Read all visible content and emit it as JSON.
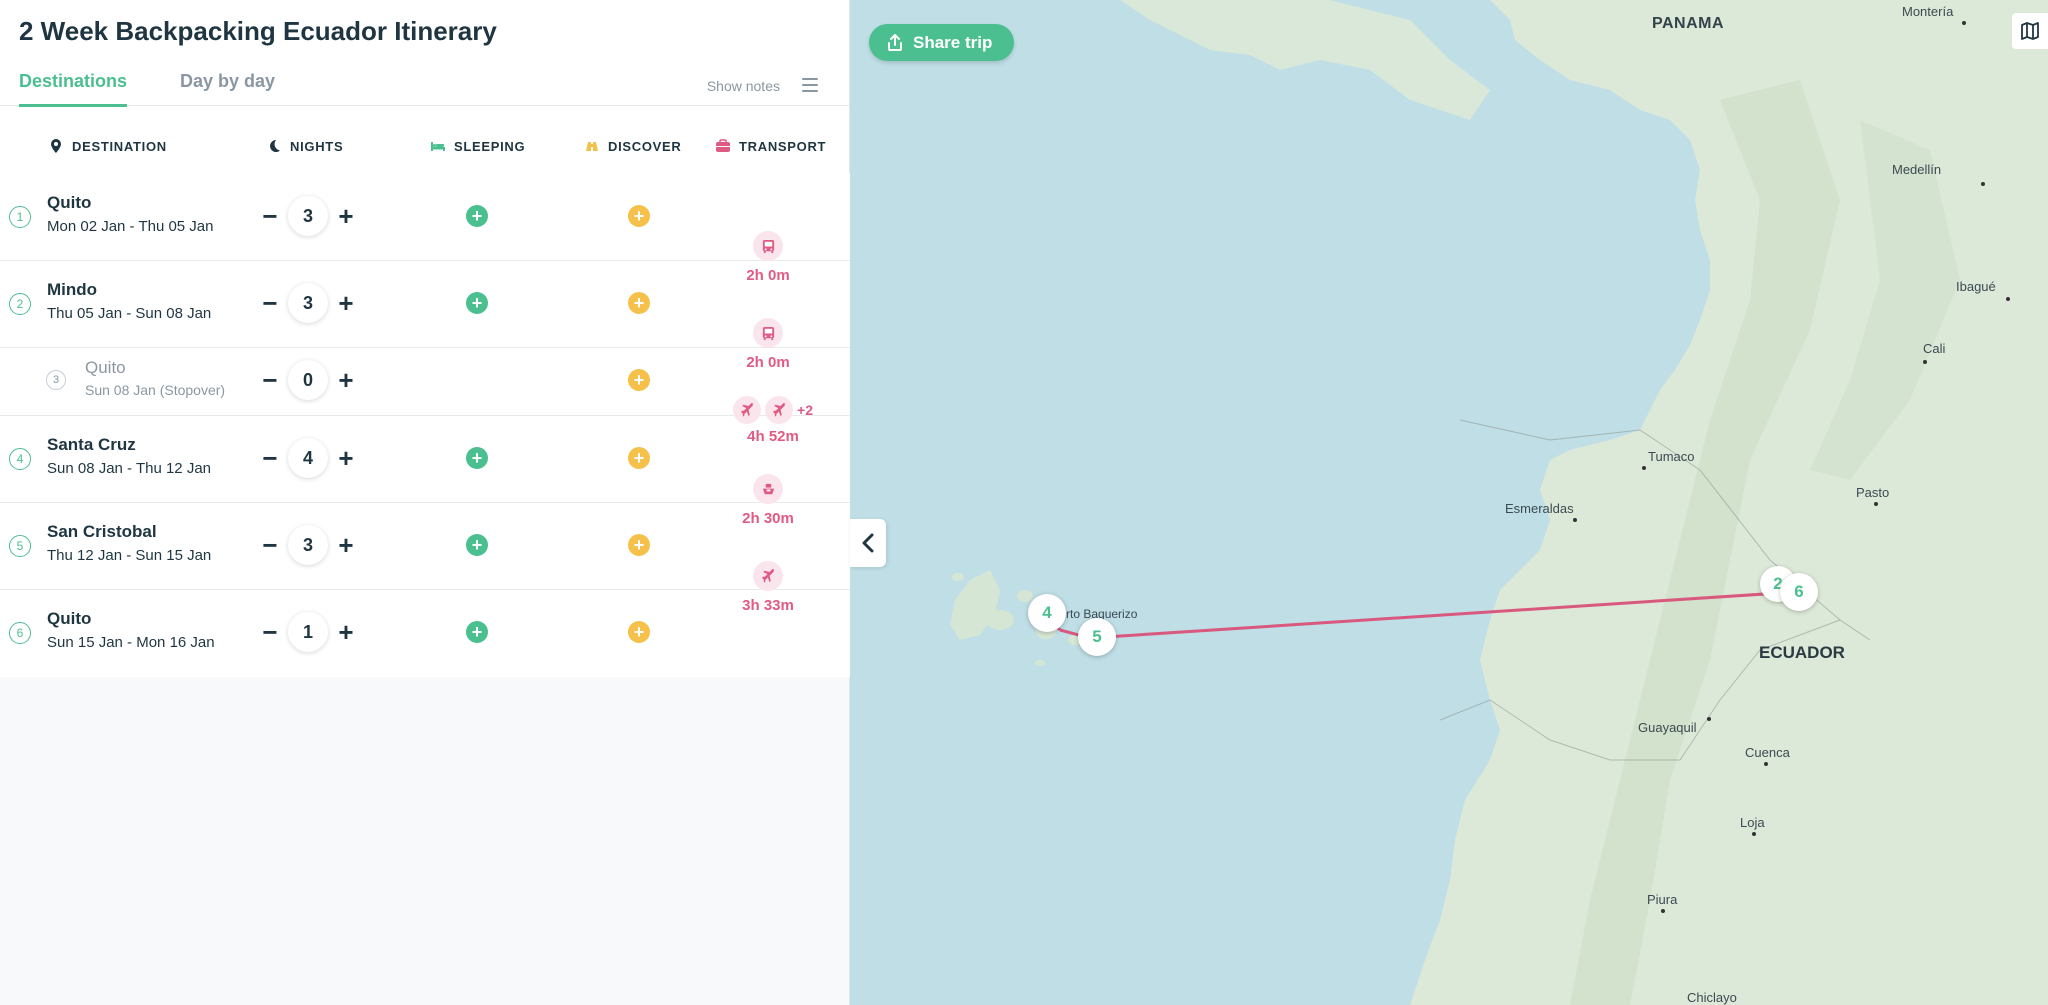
{
  "title": "2 Week Backpacking Ecuador Itinerary",
  "tabs": [
    {
      "label": "Destinations",
      "active": true
    },
    {
      "label": "Day by day",
      "active": false
    }
  ],
  "toolbar": {
    "show_notes": "Show notes"
  },
  "columns": {
    "destination": "DESTINATION",
    "nights": "NIGHTS",
    "sleeping": "SLEEPING",
    "discover": "DISCOVER",
    "transport": "TRANSPORT"
  },
  "rows": [
    {
      "num": "1",
      "name": "Quito",
      "dates": "Mon 02 Jan - Thu 05 Jan",
      "nights": "3"
    },
    {
      "num": "2",
      "name": "Mindo",
      "dates": "Thu 05 Jan - Sun 08 Jan",
      "nights": "3"
    },
    {
      "num": "3",
      "name": "Quito",
      "dates": "Sun 08 Jan (Stopover)",
      "nights": "0"
    },
    {
      "num": "4",
      "name": "Santa Cruz",
      "dates": "Sun 08 Jan - Thu 12 Jan",
      "nights": "4"
    },
    {
      "num": "5",
      "name": "San Cristobal",
      "dates": "Thu 12 Jan - Sun 15 Jan",
      "nights": "3"
    },
    {
      "num": "6",
      "name": "Quito",
      "dates": "Sun 15 Jan - Mon 16 Jan",
      "nights": "1"
    }
  ],
  "transport": [
    {
      "icon": "bus-icon",
      "time": "2h 0m"
    },
    {
      "icon": "bus-icon",
      "time": "2h 0m"
    },
    {
      "icon": "plane-icon",
      "more": "+2",
      "time": "4h 52m"
    },
    {
      "icon": "ferry-icon",
      "time": "2h 30m"
    },
    {
      "icon": "plane-icon",
      "time": "3h 33m"
    }
  ],
  "map": {
    "share_label": "Share trip",
    "labels": {
      "panama": "PANAMA",
      "ecuador": "ECUADOR",
      "monteria": "Montería",
      "medellin": "Medellín",
      "ibague": "Ibagué",
      "cali": "Cali",
      "tumaco": "Tumaco",
      "pasto": "Pasto",
      "esmeraldas": "Esmeraldas",
      "guayaquil": "Guayaquil",
      "cuenca": "Cuenca",
      "loja": "Loja",
      "piura": "Piura",
      "chiclayo": "Chiclayo",
      "puerto_baquerizo": "rto Baquerizo"
    },
    "markers": {
      "m2": "2",
      "m4": "4",
      "m5": "5",
      "m6": "6"
    }
  },
  "colors": {
    "accent": "#4bbf8f",
    "discover": "#f6c14b",
    "transport": "#e05b83",
    "text": "#1f3642",
    "route": "#d9587e"
  }
}
